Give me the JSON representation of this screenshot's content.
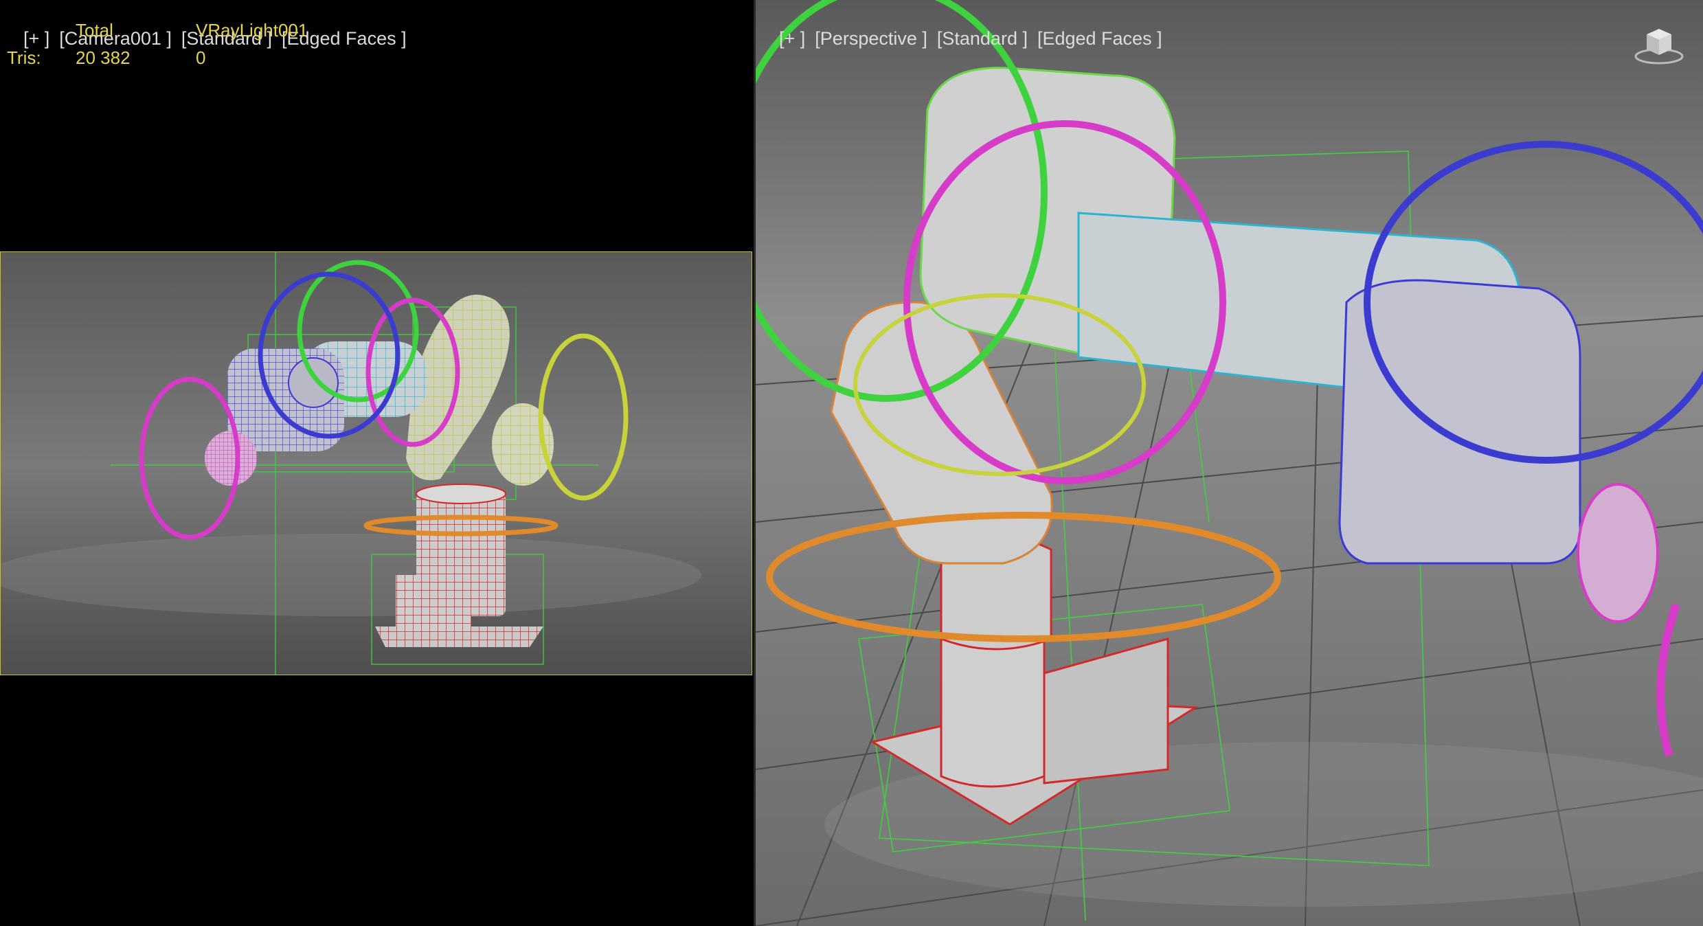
{
  "left_viewport": {
    "labels": [
      "[+ ]",
      "[Camera001 ]",
      "[Standard ]",
      "[Edged Faces ]"
    ],
    "stats": {
      "headers": [
        "",
        "Total",
        "VRayLight001"
      ],
      "row_label": "Tris:",
      "total": "20 382",
      "light": "0"
    }
  },
  "right_viewport": {
    "labels": [
      "[+ ]",
      "[Perspective ]",
      "[Standard ]",
      "[Edged Faces ]"
    ],
    "viewcube_icon": "viewcube-icon"
  },
  "colors": {
    "stats_text": "#e6d34a",
    "active_border": "#c9bf33",
    "gizmo_green": "#3ed23e",
    "gizmo_magenta": "#d63cc8",
    "gizmo_blue": "#3b3bd0",
    "gizmo_yellow": "#c8d23a",
    "gizmo_orange": "#e08a2c",
    "wire_red": "#d22a2a",
    "wire_cyan": "#2ab4d2",
    "wire_blue": "#3a3ad6",
    "wire_orange": "#d8823a"
  }
}
